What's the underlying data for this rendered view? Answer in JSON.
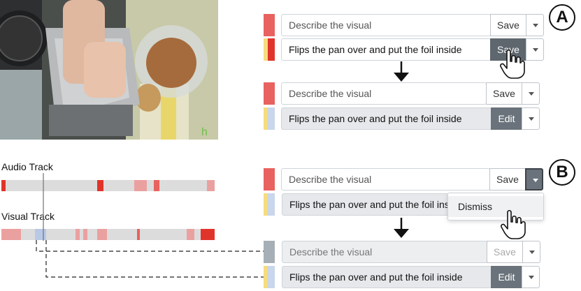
{
  "colors": {
    "audio_marker": "#e8625f",
    "visual_marker": "#f6dc7e",
    "visual_marker_selected": "#e0342a",
    "gray_marker": "#a7afb6",
    "light_marker": "#c9d6ec",
    "button_dark": "#6a737b"
  },
  "badges": {
    "a": "A",
    "b": "B"
  },
  "tracks": {
    "audio_label": "Audio Track",
    "visual_label": "Visual Track"
  },
  "panel_a": {
    "before": {
      "description_placeholder": "Describe the visual",
      "description_save": "Save",
      "visual_text": "Flips the pan over and put the foil inside",
      "visual_save": "Save"
    },
    "after": {
      "description_placeholder": "Describe the visual",
      "description_save": "Save",
      "visual_text": "Flips the pan over and put the foil inside",
      "visual_edit": "Edit"
    }
  },
  "panel_b": {
    "before": {
      "description_placeholder": "Describe the visual",
      "description_save": "Save",
      "visual_text": "Flips the pan over and put the foil inside",
      "menu_item": "Dismiss"
    },
    "after": {
      "description_placeholder": "Describe the visual",
      "description_save": "Save",
      "visual_text": "Flips the pan over and put the foil inside",
      "visual_edit": "Edit"
    }
  },
  "icons": [
    "hand-cursor-icon",
    "down-arrow-icon",
    "caret-down-icon",
    "resize-grip-icon"
  ]
}
